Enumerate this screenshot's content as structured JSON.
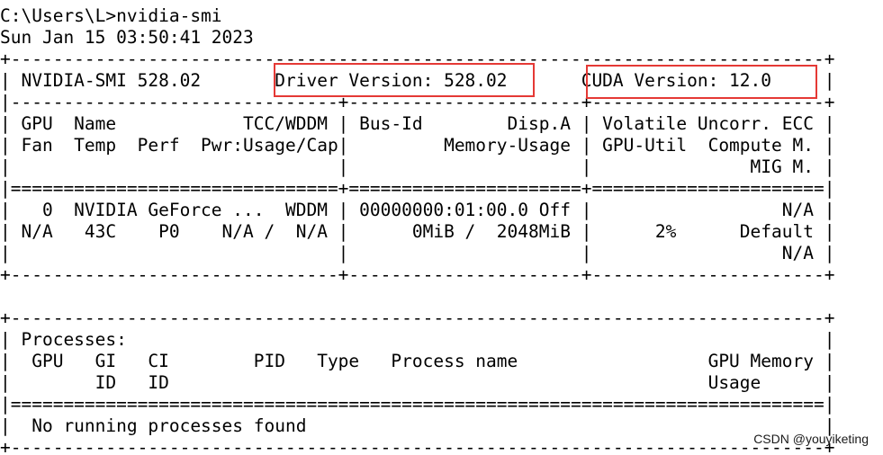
{
  "terminal": {
    "lines": [
      "C:\\Users\\L>nvidia-smi",
      "Sun Jan 15 03:50:41 2023",
      "+-----------------------------------------------------------------------------+",
      "| NVIDIA-SMI 528.02       Driver Version: 528.02       CUDA Version: 12.0     |",
      "|-------------------------------+----------------------+----------------------+",
      "| GPU  Name            TCC/WDDM | Bus-Id        Disp.A | Volatile Uncorr. ECC |",
      "| Fan  Temp  Perf  Pwr:Usage/Cap|         Memory-Usage | GPU-Util  Compute M. |",
      "|                               |                      |               MIG M. |",
      "|===============================+======================+======================|",
      "|   0  NVIDIA GeForce ...  WDDM | 00000000:01:00.0 Off |                  N/A |",
      "| N/A   43C    P0    N/A /  N/A |      0MiB /  2048MiB |      2%      Default |",
      "|                               |                      |                  N/A |",
      "+-------------------------------+----------------------+----------------------+",
      "",
      "+-----------------------------------------------------------------------------+",
      "| Processes:                                                                  |",
      "|  GPU   GI   CI        PID   Type   Process name                  GPU Memory |",
      "|        ID   ID                                                   Usage      |",
      "|=============================================================================|",
      "|  No running processes found                                                 |",
      "+-----------------------------------------------------------------------------+"
    ]
  },
  "highlight_color": "#e53935",
  "watermark": "CSDN @youyiketing"
}
